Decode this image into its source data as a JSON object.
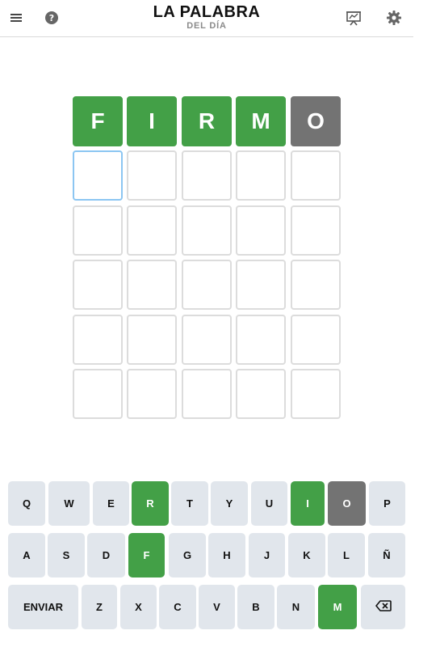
{
  "header": {
    "title": "LA PALABRA",
    "subtitle": "DEL DÍA",
    "icons": [
      "menu-icon",
      "help-icon",
      "stats-icon",
      "settings-icon"
    ]
  },
  "colors": {
    "correct": "#43a047",
    "absent": "#737373",
    "key_default": "#e1e6ec",
    "active_border": "#8cc6f2"
  },
  "board": {
    "rows": [
      [
        "F",
        "I",
        "R",
        "M",
        "O"
      ],
      [
        "",
        "",
        "",
        "",
        ""
      ],
      [
        "",
        "",
        "",
        "",
        ""
      ],
      [
        "",
        "",
        "",
        "",
        ""
      ],
      [
        "",
        "",
        "",
        "",
        ""
      ],
      [
        "",
        "",
        "",
        "",
        ""
      ]
    ],
    "states": [
      [
        "correct",
        "correct",
        "correct",
        "correct",
        "absent"
      ],
      [
        "active",
        "empty",
        "empty",
        "empty",
        "empty"
      ],
      [
        "empty",
        "empty",
        "empty",
        "empty",
        "empty"
      ],
      [
        "empty",
        "empty",
        "empty",
        "empty",
        "empty"
      ],
      [
        "empty",
        "empty",
        "empty",
        "empty",
        "empty"
      ],
      [
        "empty",
        "empty",
        "empty",
        "empty",
        "empty"
      ]
    ]
  },
  "keyboard": {
    "rows": [
      [
        {
          "label": "Q",
          "state": ""
        },
        {
          "label": "W",
          "state": ""
        },
        {
          "label": "E",
          "state": ""
        },
        {
          "label": "R",
          "state": "correct"
        },
        {
          "label": "T",
          "state": ""
        },
        {
          "label": "Y",
          "state": ""
        },
        {
          "label": "U",
          "state": ""
        },
        {
          "label": "I",
          "state": "correct"
        },
        {
          "label": "O",
          "state": "absent"
        },
        {
          "label": "P",
          "state": ""
        }
      ],
      [
        {
          "label": "A",
          "state": ""
        },
        {
          "label": "S",
          "state": ""
        },
        {
          "label": "D",
          "state": ""
        },
        {
          "label": "F",
          "state": "correct"
        },
        {
          "label": "G",
          "state": ""
        },
        {
          "label": "H",
          "state": ""
        },
        {
          "label": "J",
          "state": ""
        },
        {
          "label": "K",
          "state": ""
        },
        {
          "label": "L",
          "state": ""
        },
        {
          "label": "Ñ",
          "state": ""
        }
      ],
      [
        {
          "label": "ENVIAR",
          "state": ""
        },
        {
          "label": "Z",
          "state": ""
        },
        {
          "label": "X",
          "state": ""
        },
        {
          "label": "C",
          "state": ""
        },
        {
          "label": "V",
          "state": ""
        },
        {
          "label": "B",
          "state": ""
        },
        {
          "label": "N",
          "state": ""
        },
        {
          "label": "M",
          "state": "correct"
        },
        {
          "label": "",
          "state": "",
          "icon": "backspace-icon"
        }
      ]
    ]
  }
}
